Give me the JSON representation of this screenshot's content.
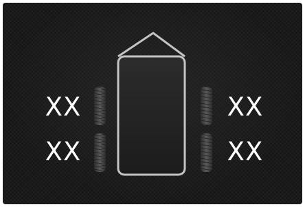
{
  "tires": {
    "front_left": {
      "pressure": "XX"
    },
    "front_right": {
      "pressure": "XX"
    },
    "rear_left": {
      "pressure": "XX"
    },
    "rear_right": {
      "pressure": "XX"
    }
  },
  "colors": {
    "background": "#161616",
    "vehicle_outline": "#c4c4c4",
    "vehicle_body": "#2a2a2a",
    "tire": "#4a4a4a",
    "text": "#ffffff"
  },
  "icons": {
    "vehicle": "vehicle-top-view-icon",
    "tire": "tire-icon"
  }
}
